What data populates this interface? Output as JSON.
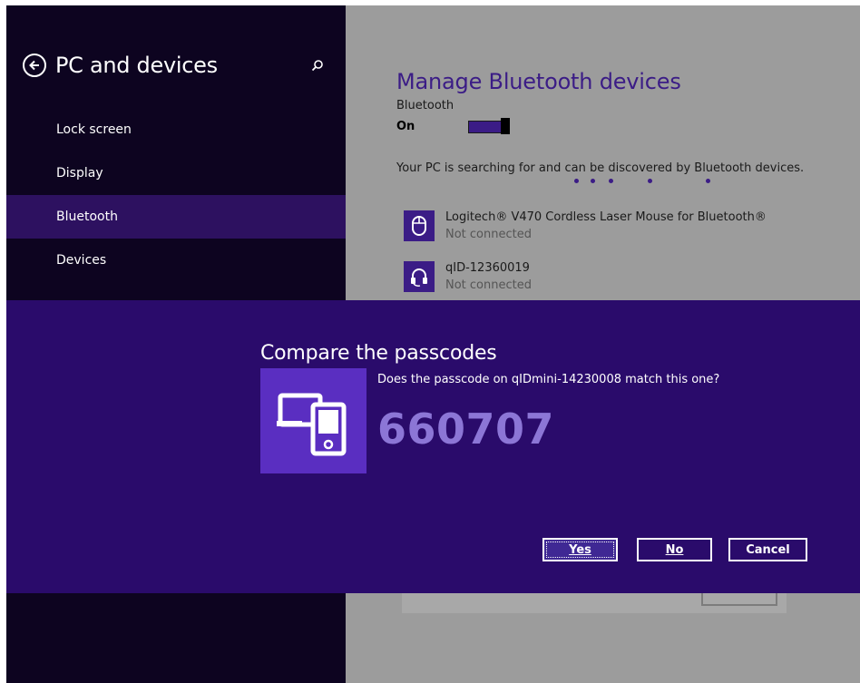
{
  "sidebar": {
    "title": "PC and devices",
    "items": [
      {
        "label": "Lock screen",
        "active": false
      },
      {
        "label": "Display",
        "active": false
      },
      {
        "label": "Bluetooth",
        "active": true
      },
      {
        "label": "Devices",
        "active": false
      }
    ]
  },
  "main": {
    "title": "Manage Bluetooth devices",
    "bluetooth_label": "Bluetooth",
    "bluetooth_state": "On",
    "searching_text": "Your PC is searching for and can be discovered by Bluetooth devices.",
    "devices": [
      {
        "name": "Logitech® V470 Cordless Laser Mouse for Bluetooth®",
        "status": "Not connected",
        "icon": "mouse-icon"
      },
      {
        "name": "qID-12360019",
        "status": "Not connected",
        "icon": "headset-icon"
      }
    ]
  },
  "dialog": {
    "title": "Compare the passcodes",
    "question": "Does the passcode on qIDmini-14230008 match this one?",
    "passcode": "660707",
    "buttons": {
      "yes": "Yes",
      "no": "No",
      "cancel": "Cancel"
    }
  },
  "colors": {
    "accent": "#3b1c86",
    "sidebar_bg": "#0d0420",
    "dialog_bg": "#2a0b6b",
    "passcode": "#8c76d6"
  }
}
